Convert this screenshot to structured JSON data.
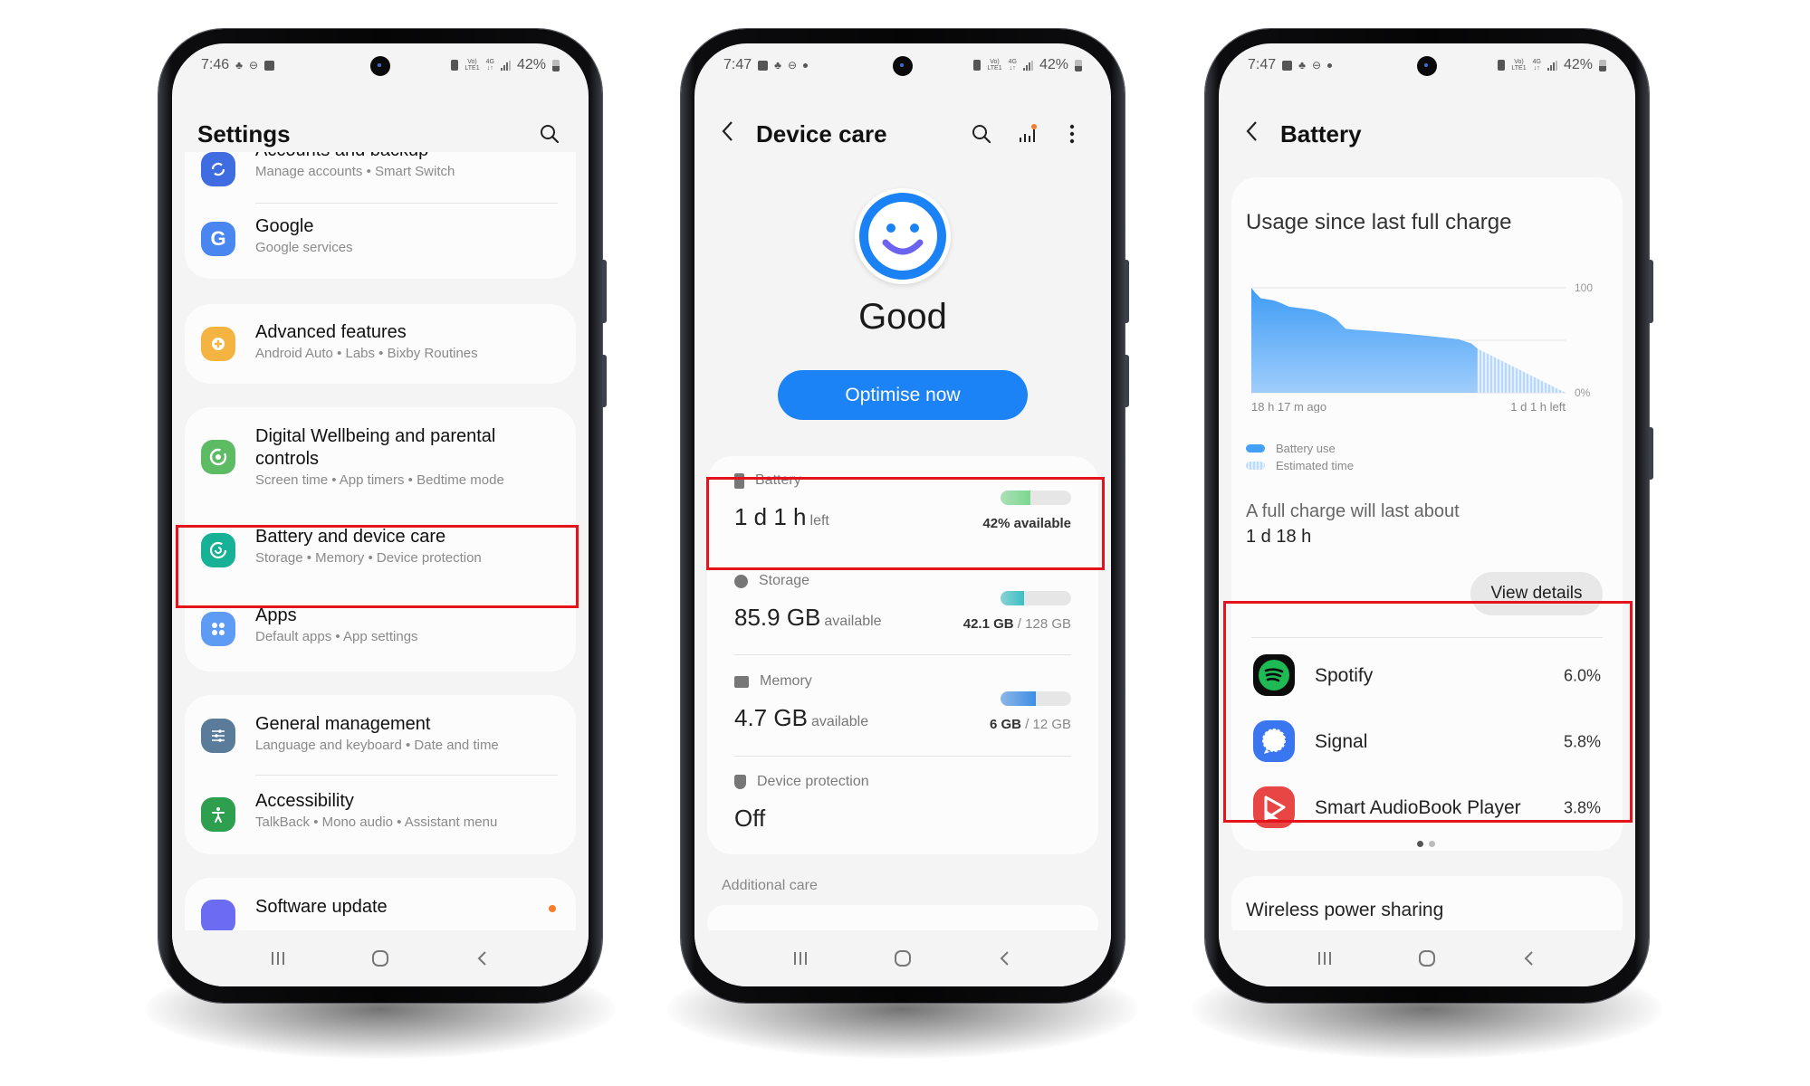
{
  "phones": {
    "settings": {
      "status": {
        "time": "7:46",
        "battery_pct": "42%"
      },
      "title": "Settings",
      "items": [
        {
          "title": "Accounts and backup",
          "subtitle": "Manage accounts  •  Smart Switch",
          "icon": "accounts-sync-icon",
          "color": "#3f6ce0"
        },
        {
          "title": "Google",
          "subtitle": "Google services",
          "icon": "google-icon",
          "color": "#4a86f0"
        },
        {
          "title": "Advanced features",
          "subtitle": "Android Auto  •  Labs  •  Bixby Routines",
          "icon": "advanced-features-icon",
          "color": "#f5b342"
        },
        {
          "title": "Digital Wellbeing and parental controls",
          "subtitle": "Screen time  •  App timers  •  Bedtime mode",
          "icon": "digital-wellbeing-icon",
          "color": "#5dbb63"
        },
        {
          "title": "Battery and device care",
          "subtitle": "Storage  •  Memory  •  Device protection",
          "icon": "device-care-icon",
          "color": "#17b295"
        },
        {
          "title": "Apps",
          "subtitle": "Default apps  •  App settings",
          "icon": "apps-icon",
          "color": "#5e9bf5"
        },
        {
          "title": "General management",
          "subtitle": "Language and keyboard  •  Date and time",
          "icon": "general-management-icon",
          "color": "#5a7b99"
        },
        {
          "title": "Accessibility",
          "subtitle": "TalkBack  •  Mono audio  •  Assistant menu",
          "icon": "accessibility-icon",
          "color": "#2e9e4f"
        },
        {
          "title": "Software update",
          "subtitle": "",
          "icon": "software-update-icon",
          "color": "#6b6cf2"
        }
      ]
    },
    "device_care": {
      "status": {
        "time": "7:47",
        "battery_pct": "42%"
      },
      "title": "Device care",
      "state": "Good",
      "optimise_label": "Optimise now",
      "battery": {
        "label": "Battery",
        "value": "1 d 1 h",
        "unit": "left",
        "detail": "42% available",
        "fill": 0.42,
        "color": "#7ad88f"
      },
      "storage": {
        "label": "Storage",
        "value": "85.9 GB",
        "unit": "available",
        "used": "42.1 GB",
        "total": "/ 128 GB",
        "fill": 0.33,
        "color": "#3bbfc4"
      },
      "memory": {
        "label": "Memory",
        "value": "4.7 GB",
        "unit": "available",
        "used": "6 GB",
        "total": "/ 12 GB",
        "fill": 0.5,
        "color": "#3e8ee6"
      },
      "protection": {
        "label": "Device protection",
        "value": "Off"
      },
      "additional_care": "Additional care"
    },
    "battery": {
      "status": {
        "time": "7:47",
        "battery_pct": "42%"
      },
      "title": "Battery",
      "usage_heading": "Usage since last full charge",
      "full_charge_label": "A full charge will last about",
      "full_charge_value": "1 d 18 h",
      "view_details": "View details",
      "apps": [
        {
          "name": "Spotify",
          "pct": "6.0%",
          "icon": "spotify-icon"
        },
        {
          "name": "Signal",
          "pct": "5.8%",
          "icon": "signal-icon"
        },
        {
          "name": "Smart AudioBook Player",
          "pct": "3.8%",
          "icon": "audiobook-icon"
        }
      ],
      "page_indicator": {
        "pages": 2,
        "current": 1
      },
      "wireless_power_sharing": "Wireless power sharing"
    }
  },
  "chart_data": {
    "type": "area",
    "title": "Usage since last full charge",
    "xlabel_start": "18 h 17 m ago",
    "xlabel_end": "1 d 1 h left",
    "y_tick_labels": [
      "100",
      "0%"
    ],
    "ylim": [
      0,
      100
    ],
    "grid": true,
    "legend": [
      "Battery use",
      "Estimated time"
    ],
    "legend_position": "bottom-left",
    "series": [
      {
        "name": "Battery use",
        "x": [
          0,
          0.01,
          0.03,
          0.07,
          0.09,
          0.12,
          0.2,
          0.24,
          0.27,
          0.3,
          0.33,
          0.38,
          0.5,
          0.6,
          0.66,
          0.7,
          0.72
        ],
        "values": [
          100,
          96,
          90,
          88,
          86,
          82,
          79,
          75,
          70,
          61,
          60,
          59,
          56,
          53,
          51,
          47,
          42
        ]
      },
      {
        "name": "Estimated time",
        "x": [
          0.42,
          1.0
        ],
        "values": [
          42,
          0
        ]
      }
    ],
    "x_domain_note": "x normalized 0..1 across full timeline; battery use spans first 42%",
    "current_level": 42
  }
}
